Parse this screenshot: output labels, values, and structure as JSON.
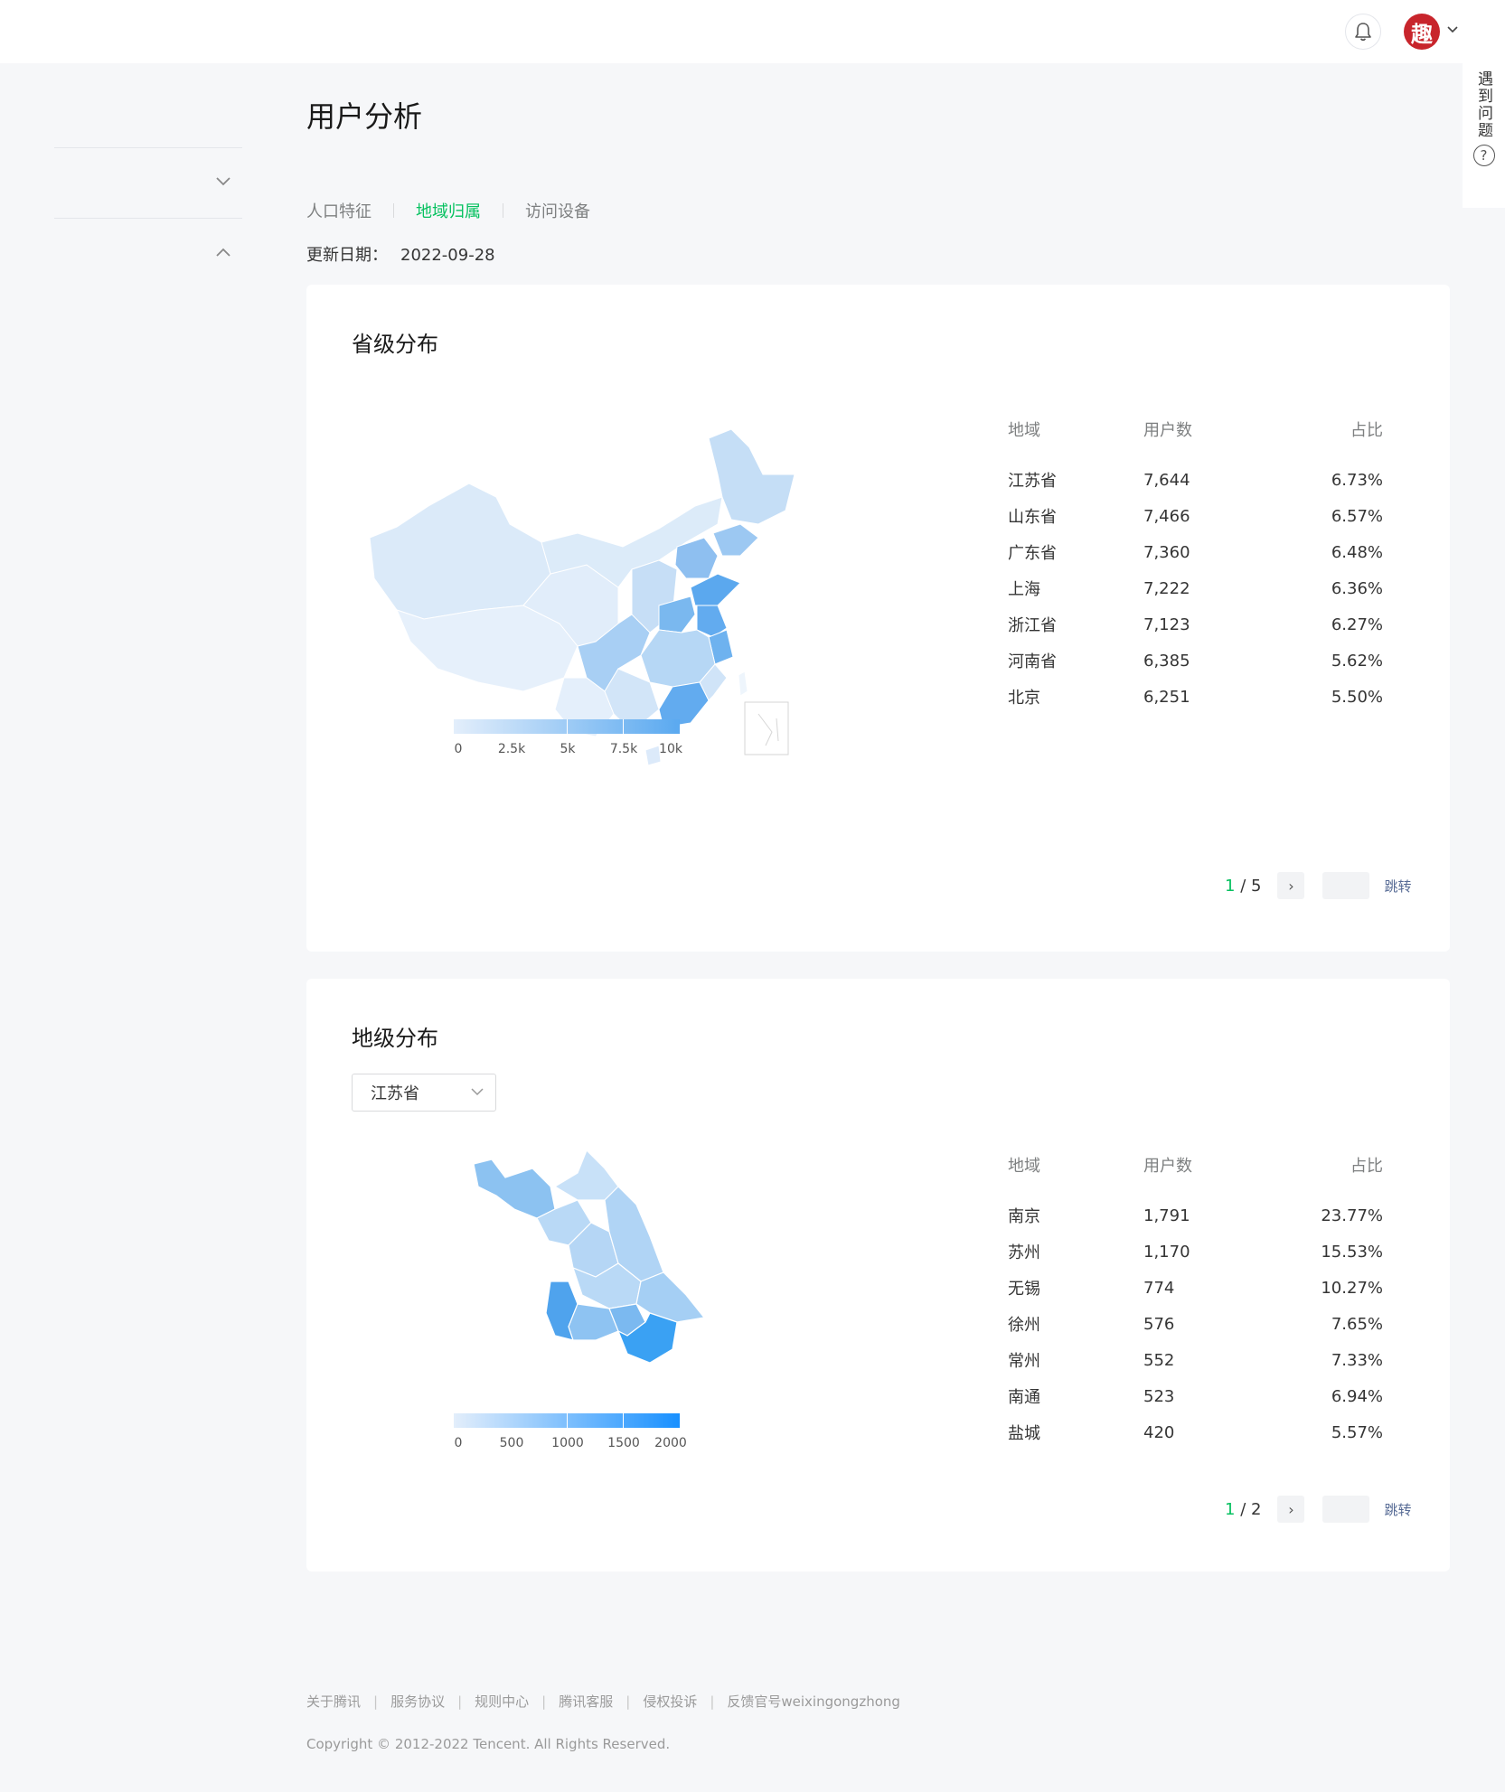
{
  "header": {
    "bell_icon": "bell-icon",
    "avatar_text": "趣",
    "avatar_color": "#c8252c"
  },
  "side_help": {
    "label": "遇到问题",
    "icon_text": "?"
  },
  "page": {
    "title": "用户分析",
    "tabs": [
      {
        "label": "人口特征",
        "active": false
      },
      {
        "label": "地域归属",
        "active": true
      },
      {
        "label": "访问设备",
        "active": false
      }
    ],
    "update_label": "更新日期：",
    "update_value": "2022-09-28"
  },
  "province": {
    "title": "省级分布",
    "columns": [
      "地域",
      "用户数",
      "占比"
    ],
    "rows": [
      {
        "region": "江苏省",
        "users": "7,644",
        "pct": "6.73%"
      },
      {
        "region": "山东省",
        "users": "7,466",
        "pct": "6.57%"
      },
      {
        "region": "广东省",
        "users": "7,360",
        "pct": "6.48%"
      },
      {
        "region": "上海",
        "users": "7,222",
        "pct": "6.36%"
      },
      {
        "region": "浙江省",
        "users": "7,123",
        "pct": "6.27%"
      },
      {
        "region": "河南省",
        "users": "6,385",
        "pct": "5.62%"
      },
      {
        "region": "北京",
        "users": "6,251",
        "pct": "5.50%"
      }
    ],
    "legend_ticks": [
      "0",
      "2.5k",
      "5k",
      "7.5k",
      "10k"
    ],
    "pager": {
      "current": "1",
      "total": "/ 5",
      "next": "›",
      "jump": "跳转"
    }
  },
  "city": {
    "title": "地级分布",
    "select_value": "江苏省",
    "columns": [
      "地域",
      "用户数",
      "占比"
    ],
    "rows": [
      {
        "region": "南京",
        "users": "1,791",
        "pct": "23.77%"
      },
      {
        "region": "苏州",
        "users": "1,170",
        "pct": "15.53%"
      },
      {
        "region": "无锡",
        "users": "774",
        "pct": "10.27%"
      },
      {
        "region": "徐州",
        "users": "576",
        "pct": "7.65%"
      },
      {
        "region": "常州",
        "users": "552",
        "pct": "7.33%"
      },
      {
        "region": "南通",
        "users": "523",
        "pct": "6.94%"
      },
      {
        "region": "盐城",
        "users": "420",
        "pct": "5.57%"
      }
    ],
    "legend_ticks": [
      "0",
      "500",
      "1000",
      "1500",
      "2000"
    ],
    "pager": {
      "current": "1",
      "total": "/ 2",
      "next": "›",
      "jump": "跳转"
    }
  },
  "footer": {
    "links": [
      "关于腾讯",
      "服务协议",
      "规则中心",
      "腾讯客服",
      "侵权投诉",
      "反馈官号weixingongzhong"
    ],
    "copyright": "Copyright © 2012-2022 Tencent. All Rights Reserved."
  },
  "colors": {
    "accent": "#07c160",
    "link": "#576b95",
    "map_light": "#e1eefb",
    "map_mid": "#a9d0f5",
    "map_dark": "#5aa9f0"
  }
}
